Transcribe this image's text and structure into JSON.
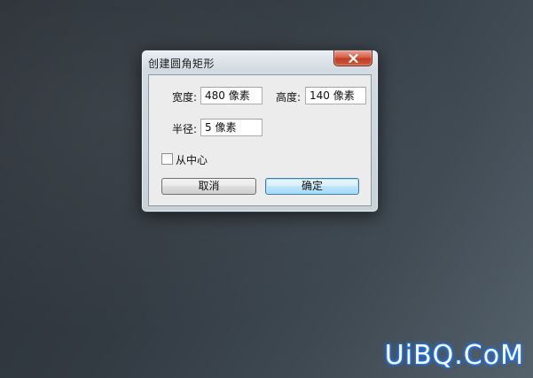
{
  "window": {
    "title": "创建圆角矩形"
  },
  "fields": {
    "width_label": "宽度:",
    "width_value": "480 像素",
    "height_label": "高度:",
    "height_value": "140 像素",
    "radius_label": "半径:",
    "radius_value": "5 像素"
  },
  "options": {
    "from_center_label": "从中心",
    "from_center_checked": false
  },
  "buttons": {
    "cancel_label": "取消",
    "ok_label": "确定"
  },
  "icons": {
    "close": "close-icon"
  },
  "colors": {
    "close_button": "#c23b22",
    "default_button_border": "#3c7fb1"
  },
  "watermark": {
    "text": "UiBQ.CoM"
  }
}
